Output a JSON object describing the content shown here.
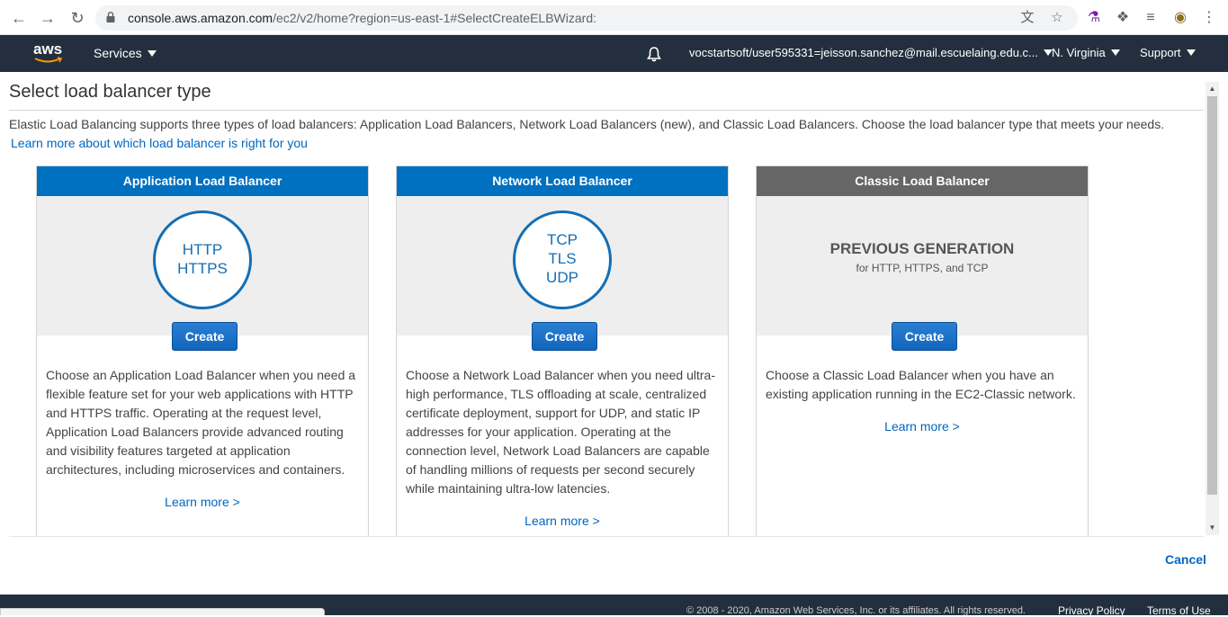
{
  "browser": {
    "url_host": "console.aws.amazon.com",
    "url_path": "/ec2/v2/home?region=us-east-1#SelectCreateELBWizard:"
  },
  "header": {
    "logo_text": "aws",
    "services_label": "Services",
    "account_label": "vocstartsoft/user595331=jeisson.sanchez@mail.escuelaing.edu.c...",
    "region_label": "N. Virginia",
    "support_label": "Support"
  },
  "page": {
    "title": "Select load balancer type",
    "intro": "Elastic Load Balancing supports three types of load balancers: Application Load Balancers, Network Load Balancers (new), and Classic Load Balancers. Choose the load balancer type that meets your needs.",
    "learn_link": "Learn more about which load balancer is right for you"
  },
  "cards": [
    {
      "title": "Application Load Balancer",
      "protocols": [
        "HTTP",
        "HTTPS"
      ],
      "create_label": "Create",
      "description": "Choose an Application Load Balancer when you need a flexible feature set for your web applications with HTTP and HTTPS traffic. Operating at the request level, Application Load Balancers provide advanced routing and visibility features targeted at application architectures, including microservices and containers.",
      "learn_label": "Learn more >"
    },
    {
      "title": "Network Load Balancer",
      "protocols": [
        "TCP",
        "TLS",
        "UDP"
      ],
      "create_label": "Create",
      "description": "Choose a Network Load Balancer when you need ultra-high performance, TLS offloading at scale, centralized certificate deployment, support for UDP, and static IP addresses for your application. Operating at the connection level, Network Load Balancers are capable of handling millions of requests per second securely while maintaining ultra-low latencies.",
      "learn_label": "Learn more >"
    },
    {
      "title": "Classic Load Balancer",
      "generation_label": "PREVIOUS GENERATION",
      "generation_sub": "for HTTP, HTTPS, and TCP",
      "create_label": "Create",
      "description": "Choose a Classic Load Balancer when you have an existing application running in the EC2-Classic network.",
      "learn_label": "Learn more >"
    }
  ],
  "actions": {
    "cancel_label": "Cancel"
  },
  "footer": {
    "copyright": "© 2008 - 2020, Amazon Web Services, Inc. or its affiliates. All rights reserved.",
    "privacy_label": "Privacy Policy",
    "terms_label": "Terms of Use"
  },
  "colors": {
    "header_bg": "#232f3e",
    "card_head_blue": "#0070c0",
    "card_head_gray": "#666666",
    "link": "#0066c0",
    "aws_orange": "#ff9900"
  }
}
